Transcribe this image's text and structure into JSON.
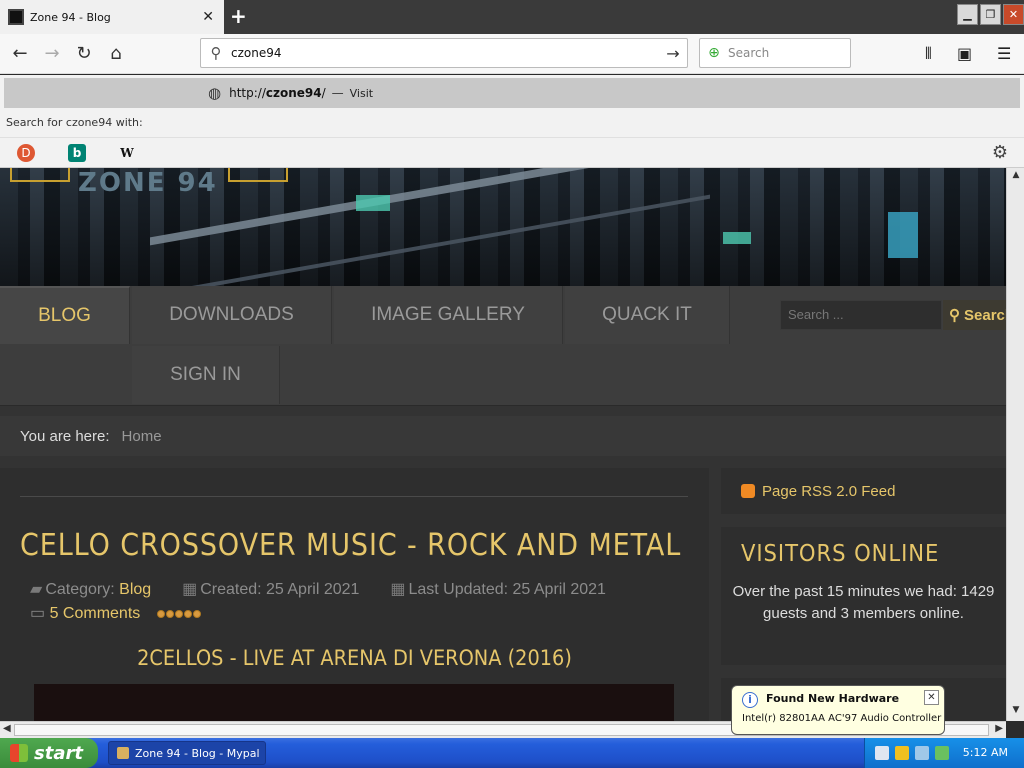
{
  "browser": {
    "tab_title": "Zone 94 - Blog",
    "tab_close": "✕",
    "new_tab": "+",
    "url_value": "czone94",
    "search_placeholder": "Search",
    "suggestion": {
      "url_prefix": "http://",
      "url_bold": "czone94",
      "url_suffix": "/",
      "separator": "—",
      "visit": "Visit"
    },
    "search_with_label": "Search for czone94 with:",
    "engines": [
      {
        "name": "DuckDuckGo",
        "glyph": "D"
      },
      {
        "name": "Bing",
        "glyph": "b"
      },
      {
        "name": "Wikipedia",
        "glyph": "W"
      }
    ]
  },
  "site": {
    "banner_logo": "ZONE 94",
    "menu": [
      {
        "label": "BLOG",
        "active": true
      },
      {
        "label": "DOWNLOADS",
        "active": false
      },
      {
        "label": "IMAGE GALLERY",
        "active": false
      },
      {
        "label": "QUACK IT",
        "active": false
      },
      {
        "label": "SIGN IN",
        "active": false
      }
    ],
    "search_placeholder": "Search ...",
    "search_button": "Search",
    "breadcrumb_label": "You are here:",
    "breadcrumb_home": "Home"
  },
  "article": {
    "title": "CELLO CROSSOVER MUSIC - ROCK AND METAL",
    "category_label": "Category:",
    "category_value": "Blog",
    "created": "Created: 25 April 2021",
    "updated": "Last Updated: 25 April 2021",
    "comments": "5 Comments",
    "rating_stars": 5,
    "subheading": "2CELLOS - LIVE AT ARENA DI VERONA (2016)"
  },
  "sidebar": {
    "rss": "Page RSS 2.0 Feed",
    "visitors_title": "VISITORS ONLINE",
    "visitors_text": "Over the past 15 minutes we had: 1429 guests and 3 members online."
  },
  "notification": {
    "title": "Found New Hardware",
    "message": "Intel(r) 82801AA AC'97 Audio Controller"
  },
  "taskbar": {
    "start": "start",
    "window_item": "Zone 94 - Blog - Mypal",
    "clock": "5:12 AM"
  },
  "colors": {
    "accent_gold": "#e6c66a",
    "page_bg": "#333333",
    "taskbar_blue": "#245edb",
    "start_green": "#3b8c3b"
  }
}
